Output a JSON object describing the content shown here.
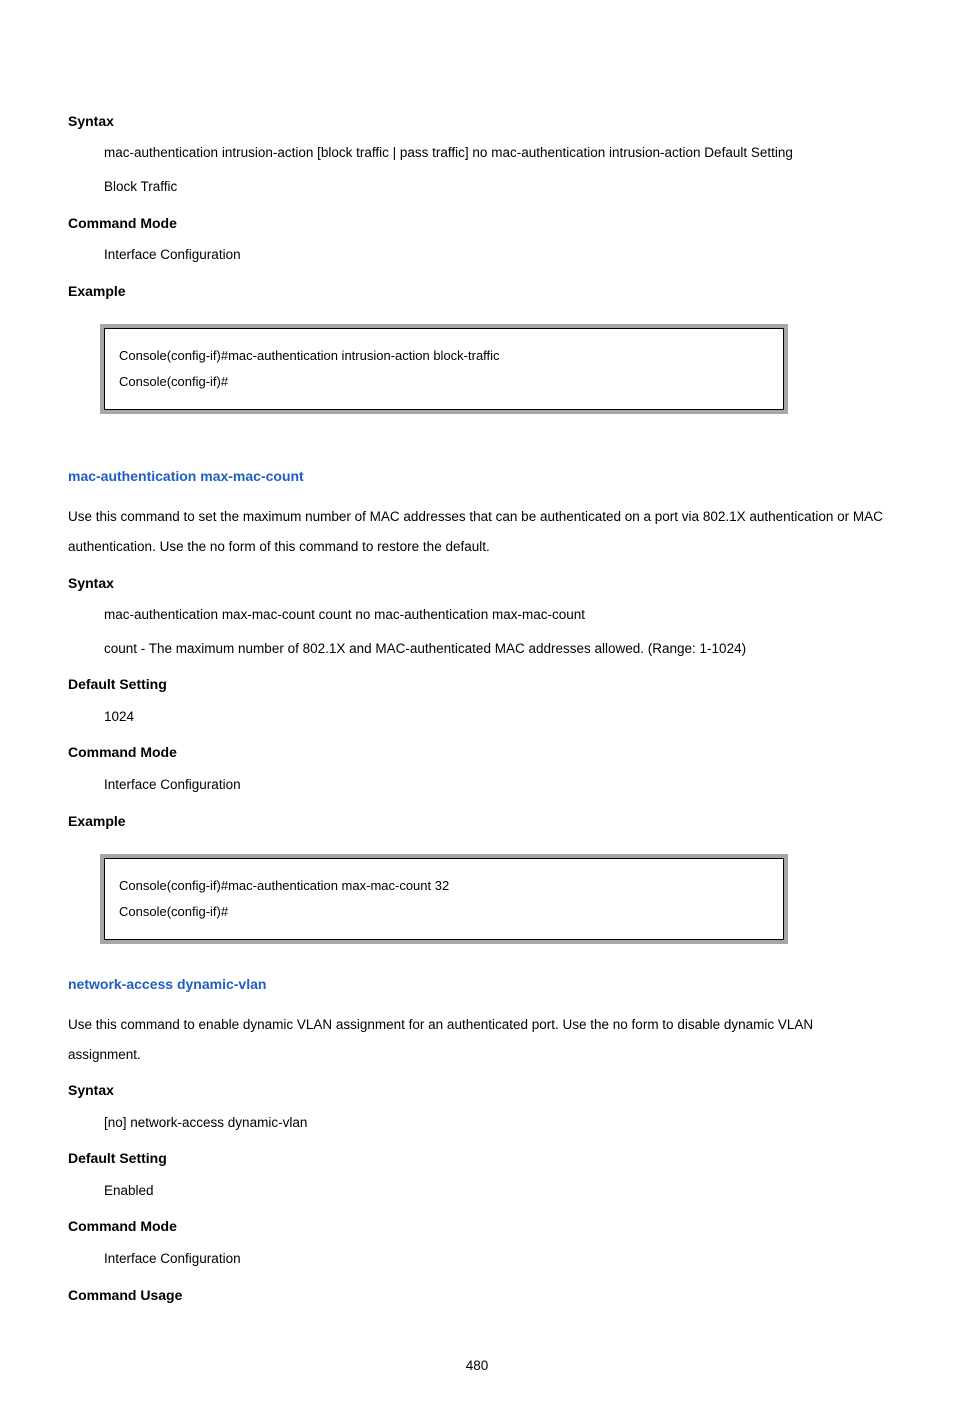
{
  "sec1": {
    "syntax_h": "Syntax",
    "syntax_body": "mac-authentication intrusion-action [block traffic | pass traffic] no mac-authentication intrusion-action Default Setting",
    "syntax_body2": "Block Traffic",
    "cmdmode_h": "Command Mode",
    "cmdmode_body": "Interface Configuration",
    "example_h": "Example",
    "code1": "Console(config-if)#mac-authentication intrusion-action block-traffic",
    "code2": "Console(config-if)#"
  },
  "sec2": {
    "heading": "mac-authentication max-mac-count",
    "intro": "Use this command to set the maximum number of MAC addresses that can be authenticated on a port via 802.1X authentication or MAC authentication. Use the no form of this command to restore the default.",
    "syntax_h": "Syntax",
    "syntax_line1": "mac-authentication max-mac-count count no mac-authentication max-mac-count",
    "syntax_line2": "count - The maximum number of 802.1X and MAC-authenticated MAC addresses allowed. (Range: 1-1024)",
    "default_h": "Default Setting",
    "default_body": "1024",
    "cmdmode_h": "Command Mode",
    "cmdmode_body": "Interface Configuration",
    "example_h": "Example",
    "code1": "Console(config-if)#mac-authentication max-mac-count 32",
    "code2": "Console(config-if)#"
  },
  "sec3": {
    "heading": "network-access dynamic-vlan",
    "intro": "Use this command to enable dynamic VLAN assignment for an authenticated port. Use the no form to disable dynamic VLAN assignment.",
    "syntax_h": "Syntax",
    "syntax_body": "[no] network-access dynamic-vlan",
    "default_h": "Default Setting",
    "default_body": "Enabled",
    "cmdmode_h": "Command Mode",
    "cmdmode_body": "Interface Configuration",
    "usage_h": "Command Usage"
  },
  "page_number": "480"
}
